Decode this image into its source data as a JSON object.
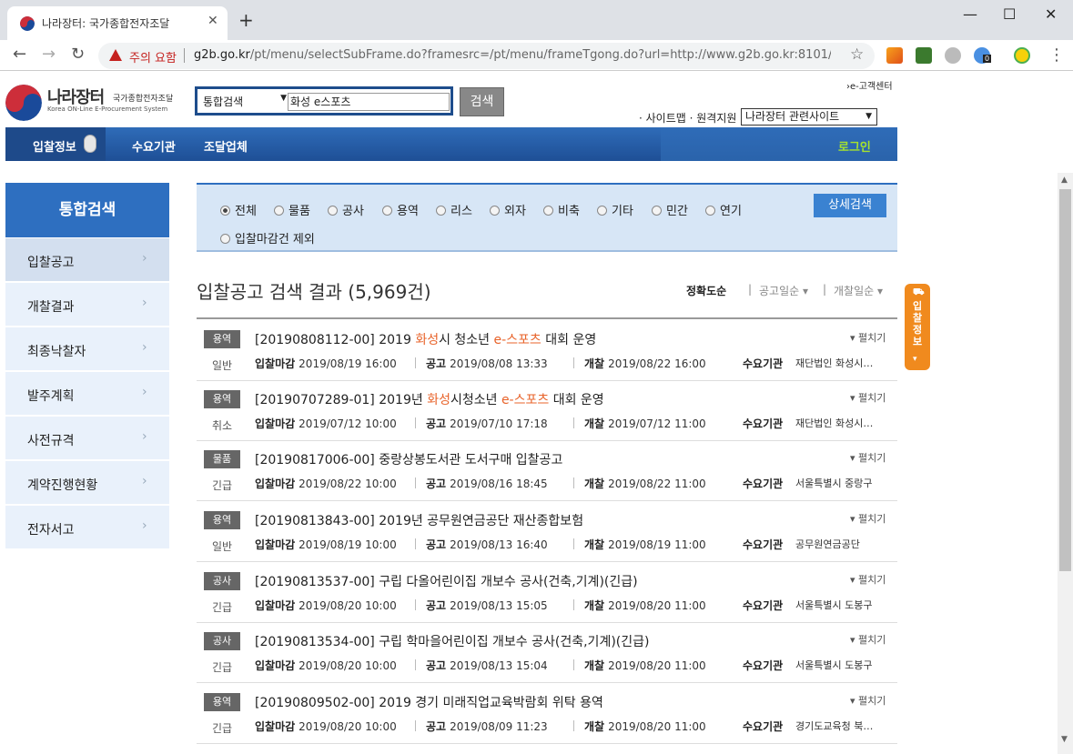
{
  "browser": {
    "tab_title": "나라장터: 국가종합전자조달",
    "tab_close": "✕",
    "new_tab": "+",
    "security_warning": "주의 요함",
    "url_host": "g2b.go.kr",
    "url_path": "/pt/menu/selectSubFrame.do?framesrc=/pt/menu/frameTgong.do?url=http://www.g2b.go.kr:8101/...",
    "ext_badge": "0"
  },
  "header": {
    "logo_ko": "나라장터",
    "logo_sub": "국가종합전자조달",
    "logo_en": "Korea ON-Line E-Procurement System",
    "search_type": "통합검색",
    "search_value": "화성 e스포츠",
    "search_button": "검색",
    "ecenter": "›e-고객센터",
    "sitemap": "· 사이트맵 · 원격지원",
    "related_site": "나라장터 관련사이트"
  },
  "nav": {
    "items": [
      "입찰정보",
      "수요기관",
      "조달업체"
    ],
    "login": "로그인"
  },
  "sidebar": {
    "title": "통합검색",
    "items": [
      "입찰공고",
      "개찰결과",
      "최종낙찰자",
      "발주계획",
      "사전규격",
      "계약진행현황",
      "전자서고"
    ]
  },
  "filters": {
    "options": [
      "전체",
      "물품",
      "공사",
      "용역",
      "리스",
      "외자",
      "비축",
      "기타",
      "민간",
      "연기",
      "입찰마감건 제외"
    ],
    "selected": "전체",
    "detail_button": "상세검색"
  },
  "results": {
    "title": "입찰공고 검색 결과 (5,969건)",
    "sort_options": [
      "정확도순",
      "공고일순 ▾",
      "개찰일순 ▾"
    ],
    "fold_label": "▾ 펼치기",
    "labels": {
      "deadline": "입찰마감",
      "notice": "공고",
      "open": "개찰",
      "agency": "수요기관"
    },
    "rows": [
      {
        "badge": "용역",
        "kind": "일반",
        "title_pre": "[20190808112-00] 2019 ",
        "hl1": "화성",
        "mid": "시 청소년 ",
        "hl2": "e-스포츠",
        "post": " 대회 운영",
        "deadline": "2019/08/19 16:00",
        "notice": "2019/08/08 13:33",
        "open": "2019/08/22 16:00",
        "agency": "재단법인 화성시…"
      },
      {
        "badge": "용역",
        "kind": "취소",
        "title_pre": "[20190707289-01] 2019년 ",
        "hl1": "화성",
        "mid": "시청소년 ",
        "hl2": "e-스포츠",
        "post": " 대회 운영",
        "deadline": "2019/07/12 10:00",
        "notice": "2019/07/10 17:18",
        "open": "2019/07/12 11:00",
        "agency": "재단법인 화성시…"
      },
      {
        "badge": "물품",
        "kind": "긴급",
        "title_pre": "[20190817006-00] 중랑상봉도서관 도서구매 입찰공고",
        "hl1": "",
        "mid": "",
        "hl2": "",
        "post": "",
        "deadline": "2019/08/22 10:00",
        "notice": "2019/08/16 18:45",
        "open": "2019/08/22 11:00",
        "agency": "서울특별시 중랑구"
      },
      {
        "badge": "용역",
        "kind": "일반",
        "title_pre": "[20190813843-00] 2019년 공무원연금공단 재산종합보험",
        "hl1": "",
        "mid": "",
        "hl2": "",
        "post": "",
        "deadline": "2019/08/19 10:00",
        "notice": "2019/08/13 16:40",
        "open": "2019/08/19 11:00",
        "agency": "공무원연금공단"
      },
      {
        "badge": "공사",
        "kind": "긴급",
        "title_pre": "[20190813537-00] 구립 다올어린이집 개보수 공사(건축,기계)(긴급)",
        "hl1": "",
        "mid": "",
        "hl2": "",
        "post": "",
        "deadline": "2019/08/20 10:00",
        "notice": "2019/08/13 15:05",
        "open": "2019/08/20 11:00",
        "agency": "서울특별시 도봉구"
      },
      {
        "badge": "공사",
        "kind": "긴급",
        "title_pre": "[20190813534-00] 구립 학마을어린이집 개보수 공사(건축,기계)(긴급)",
        "hl1": "",
        "mid": "",
        "hl2": "",
        "post": "",
        "deadline": "2019/08/20 10:00",
        "notice": "2019/08/13 15:04",
        "open": "2019/08/20 11:00",
        "agency": "서울특별시 도봉구"
      },
      {
        "badge": "용역",
        "kind": "긴급",
        "title_pre": "[20190809502-00] 2019 경기 미래직업교육박람회 위탁 용역",
        "hl1": "",
        "mid": "",
        "hl2": "",
        "post": "",
        "deadline": "2019/08/20 10:00",
        "notice": "2019/08/09 11:23",
        "open": "2019/08/20 11:00",
        "agency": "경기도교육청 북…"
      }
    ]
  },
  "float_tab": "입찰정보"
}
